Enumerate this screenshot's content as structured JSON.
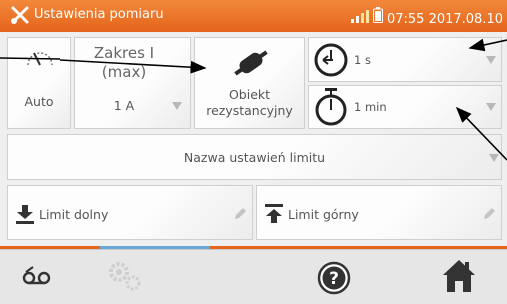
{
  "header": {
    "title": "Ustawienia pomiaru",
    "time": "07:55",
    "date": "2017.08.10"
  },
  "auto_tile": {
    "label": "Auto"
  },
  "range_tile": {
    "title": "Zakres I",
    "subtitle": "(max)",
    "value": "1 A"
  },
  "object_tile": {
    "line1": "Obiekt",
    "line2": "rezystancyjny"
  },
  "time1_tile": {
    "value": "1 s"
  },
  "time2_tile": {
    "value": "1 min"
  },
  "limit_name": {
    "label": "Nazwa ustawień limitu"
  },
  "limit_low": {
    "label": "Limit dolny"
  },
  "limit_high": {
    "label": "Limit górny"
  },
  "bottom_nav": [
    {
      "icon": "voicemail-icon"
    },
    {
      "icon": "gears-icon"
    },
    {
      "icon": "help-icon"
    },
    {
      "icon": "home-icon"
    }
  ],
  "colors": {
    "accent": "#e4651c",
    "header_text": "#ffffff",
    "tab_active": "#6aa6d6"
  }
}
